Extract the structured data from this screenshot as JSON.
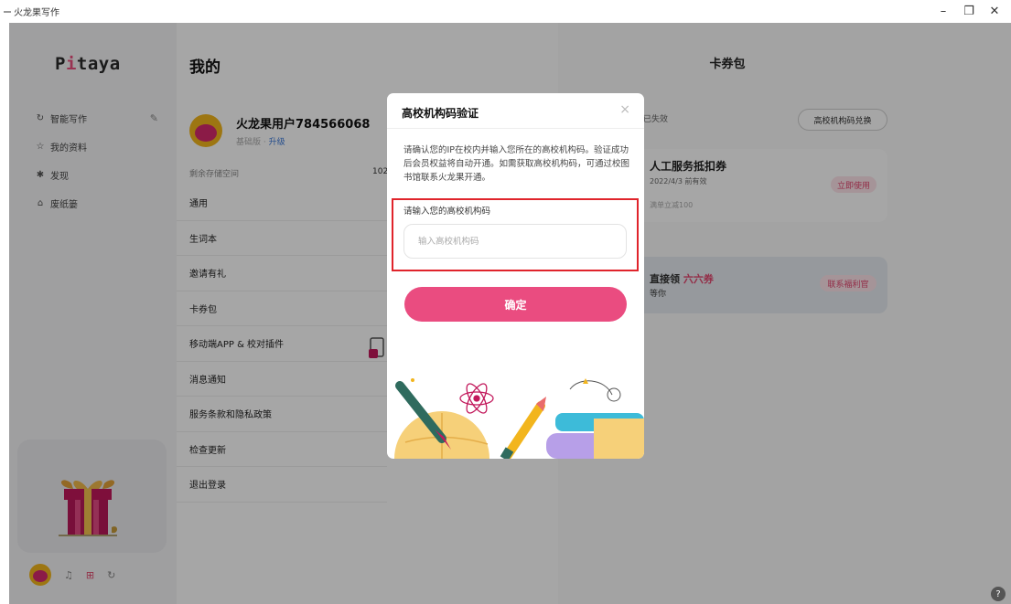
{
  "window": {
    "title": "火龙果写作",
    "controls": [
      "–",
      "❐",
      "✕"
    ]
  },
  "sidebar": {
    "logo_prefix": "P",
    "logo_accent": "i",
    "logo_suffix": "taya",
    "items": [
      {
        "label": "智能写作",
        "icon": "refresh-icon"
      },
      {
        "label": "我的资料",
        "icon": "star-icon"
      },
      {
        "label": "发现",
        "icon": "compass-icon"
      },
      {
        "label": "废纸篓",
        "icon": "trash-icon"
      }
    ]
  },
  "profile": {
    "page_title": "我的",
    "username": "火龙果用户784566068",
    "tier": "基础版",
    "upgrade": "升级",
    "storage_label": "剩余存储空间",
    "storage_value": "102"
  },
  "menu": [
    "通用",
    "生词本",
    "邀请有礼",
    "卡券包",
    "移动端APP & 校对插件",
    "消息通知",
    "服务条款和隐私政策",
    "检查更新",
    "退出登录"
  ],
  "wallet": {
    "title": "卡券包",
    "expired": "已失效",
    "redeem_button": "高校机构码兑换",
    "coupon": {
      "name": "人工服务抵扣券",
      "date": "2022/4/3 前有效",
      "note": "满单立减100",
      "use_button": "立即使用"
    },
    "benefit": {
      "line1_prefix": "直接领 ",
      "line1_em": "六六券",
      "line2": "等你",
      "contact_button": "联系福利官"
    }
  },
  "dialog": {
    "title": "高校机构码验证",
    "close": "×",
    "description": "请确认您的IP在校内并输入您所在的高校机构码。验证成功后会员权益将自动开通。如需获取高校机构码，可通过校图书馆联系火龙果开通。",
    "field_label": "请输入您的高校机构码",
    "field_placeholder": "输入高校机构码",
    "field_value": "",
    "confirm": "确定"
  },
  "colors": {
    "accent": "#ea4c80",
    "highlight": "#e0242b"
  },
  "help": "?"
}
